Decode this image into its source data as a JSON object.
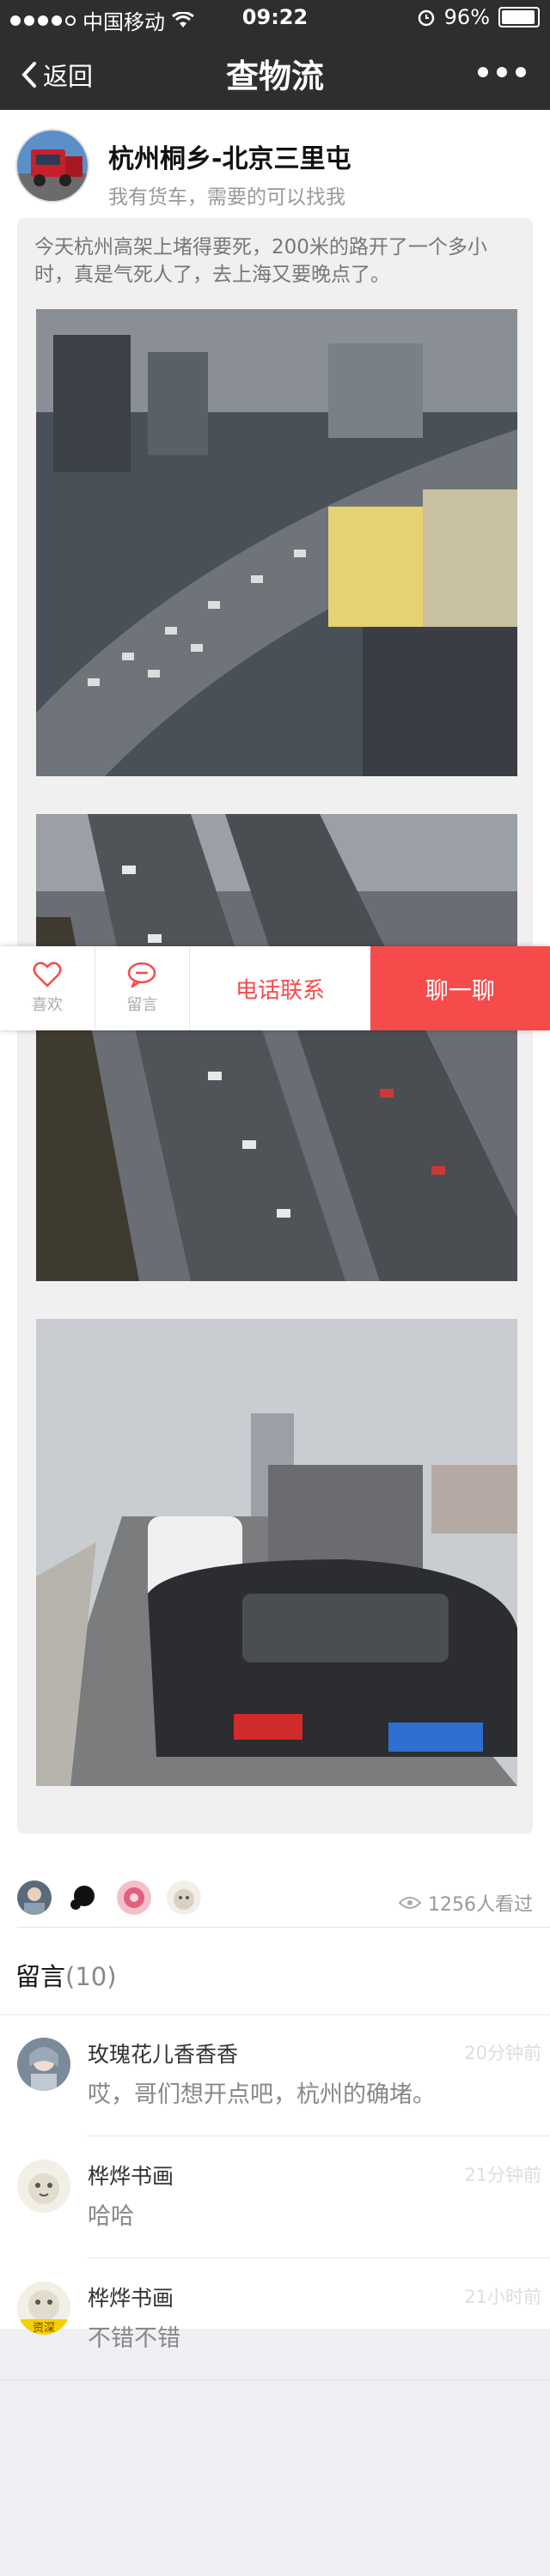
{
  "status_bar": {
    "carrier": "中国移动",
    "time": "09:22",
    "battery": "96%"
  },
  "nav": {
    "back_label": "返回",
    "title": "查物流"
  },
  "author": {
    "name": "杭州桐乡-北京三里屯",
    "subtitle": "我有货车，需要的可以找我"
  },
  "post": {
    "text": "今天杭州高架上堵得要死，200米的路开了一个多小时，真是气死人了，去上海又要晚点了。",
    "photos": [
      "traffic-photo-1",
      "traffic-photo-2",
      "traffic-photo-3"
    ]
  },
  "actions": {
    "like_label": "喜欢",
    "comment_label": "留言",
    "phone_label": "电话联系",
    "chat_label": "聊一聊"
  },
  "likers": [
    "liker-avatar-1",
    "liker-avatar-2",
    "liker-avatar-3",
    "liker-avatar-4"
  ],
  "views": "1256人看过",
  "comments_section": {
    "title": "留言",
    "count": "(10)",
    "items": [
      {
        "name": "玫瑰花儿香香香",
        "time": "20分钟前",
        "text": "哎，哥们想开点吧，杭州的确堵。"
      },
      {
        "name": "桦烨书画",
        "time": "21分钟前",
        "text": "哈哈"
      },
      {
        "name": "桦烨书画",
        "time": "21小时前",
        "text": "不错不错",
        "badge": "资深"
      }
    ]
  },
  "colors": {
    "accent": "#f54b4b",
    "navbar": "#2e2e2e",
    "page_bg": "#efeff4"
  }
}
